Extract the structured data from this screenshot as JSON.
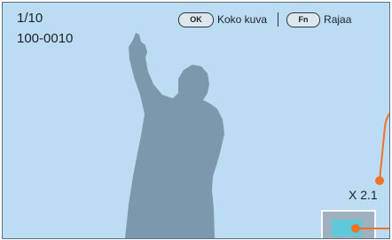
{
  "playback": {
    "image_counter": "1/10",
    "file_number": "100-0010"
  },
  "hints": {
    "ok_button": "OK",
    "ok_label": "Koko kuva",
    "fn_button": "Fn",
    "fn_label": "Rajaa"
  },
  "zoom": {
    "level_text": "X 2.1"
  },
  "colors": {
    "screen_background": "#bcdcf4",
    "silhouette": "#7c98ad",
    "callout": "#f0712b",
    "navigator_window": "#5ec9d8"
  }
}
